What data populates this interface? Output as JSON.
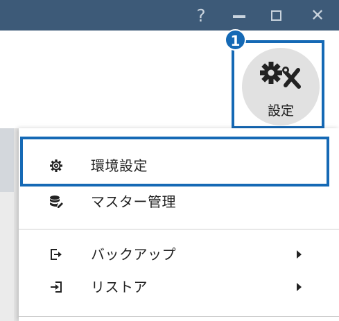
{
  "titlebar": {
    "help": "?",
    "close": "✕",
    "bg_color": "#3d5a78"
  },
  "toolbar": {
    "settings_label": "設定",
    "step_number": "1",
    "accent_color": "#1569b5"
  },
  "menu": {
    "items": [
      {
        "label": "環境設定",
        "icon": "gear-icon",
        "submenu": false
      },
      {
        "label": "マスター管理",
        "icon": "database-edit-icon",
        "submenu": false
      },
      {
        "label": "バックアップ",
        "icon": "export-icon",
        "submenu": true
      },
      {
        "label": "リストア",
        "icon": "import-icon",
        "submenu": true
      }
    ]
  }
}
